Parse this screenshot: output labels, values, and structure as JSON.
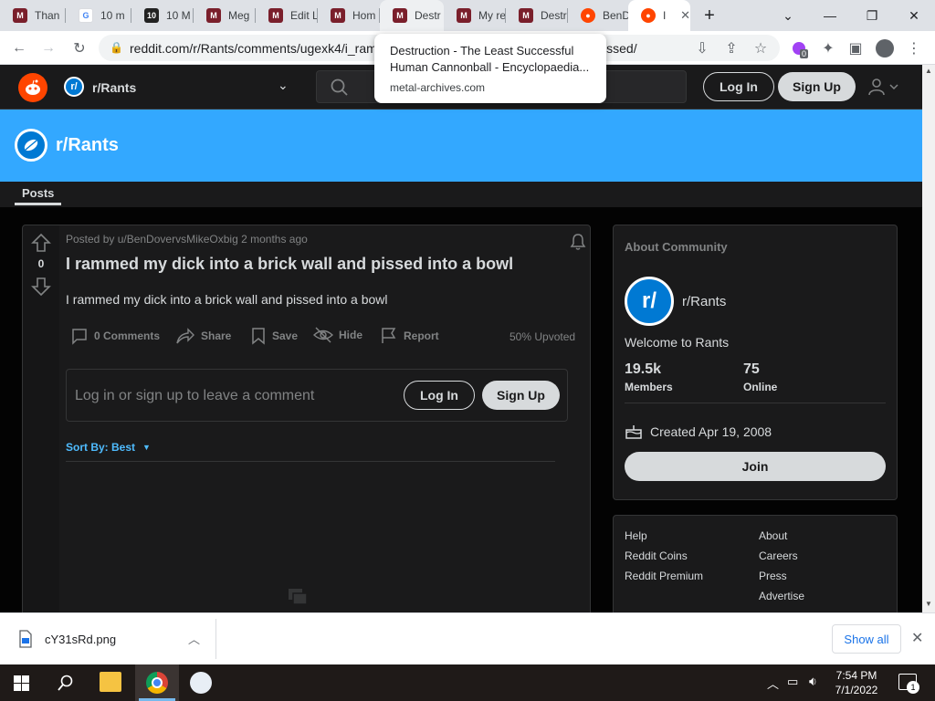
{
  "browser": {
    "tabs": [
      {
        "title": "Than",
        "icon": "metal-archives-icon"
      },
      {
        "title": "10 m",
        "icon": "google-icon"
      },
      {
        "title": "10 M",
        "icon": "ten-icon"
      },
      {
        "title": "Meg",
        "icon": "metal-archives-icon"
      },
      {
        "title": "Edit L",
        "icon": "metal-archives-icon"
      },
      {
        "title": "Hom",
        "icon": "metal-archives-icon"
      },
      {
        "title": "Destr",
        "icon": "metal-archives-icon"
      },
      {
        "title": "My re",
        "icon": "metal-archives-icon"
      },
      {
        "title": "Destr",
        "icon": "metal-archives-icon"
      },
      {
        "title": "BenD",
        "icon": "reddit-icon"
      },
      {
        "title": "I",
        "icon": "reddit-icon"
      }
    ],
    "url": "reddit.com/r/Rants/comments/ugexk4/i_rammed_my_dick_into_a_brick_wall_and_pissed/",
    "url_visible_tail": "ed/",
    "tooltip": {
      "title_line1": "Destruction - The Least Successful",
      "title_line2": "Human Cannonball - Encyclopaedia...",
      "domain": "metal-archives.com"
    },
    "extension_badge": "0"
  },
  "header": {
    "community": "r/Rants",
    "login_label": "Log In",
    "signup_label": "Sign Up"
  },
  "banner": {
    "title": "r/Rants"
  },
  "subnav": {
    "tab": "Posts"
  },
  "post": {
    "votes": "0",
    "meta": "Posted by u/BenDovervsMikeOxbig 2 months ago",
    "title": "I rammed my dick into a brick wall and pissed into a bowl",
    "body": "I rammed my dick into a brick wall and pissed into a bowl",
    "actions": {
      "comments": "0 Comments",
      "share": "Share",
      "save": "Save",
      "hide": "Hide",
      "report": "Report",
      "upvoted": "50% Upvoted"
    },
    "comment_prompt": "Log in or sign up to leave a comment",
    "login_label": "Log In",
    "signup_label": "Sign Up",
    "sort_label": "Sort By: Best"
  },
  "about": {
    "heading": "About Community",
    "name": "r/Rants",
    "welcome": "Welcome to Rants",
    "members_value": "19.5k",
    "members_label": "Members",
    "online_value": "75",
    "online_label": "Online",
    "created": "Created Apr 19, 2008",
    "join_label": "Join"
  },
  "footer_links": {
    "left": [
      "Help",
      "Reddit Coins",
      "Reddit Premium"
    ],
    "right": [
      "About",
      "Careers",
      "Press",
      "Advertise"
    ]
  },
  "download": {
    "filename": "cY31sRd.png",
    "show_all": "Show all"
  },
  "taskbar": {
    "time": "7:54 PM",
    "date": "7/1/2022",
    "notification_count": "1"
  },
  "colors": {
    "reddit_orange": "#ff4500",
    "banner_blue": "#33a8ff",
    "card_bg": "#1a1a1b",
    "link_blue": "#4fbcff"
  }
}
